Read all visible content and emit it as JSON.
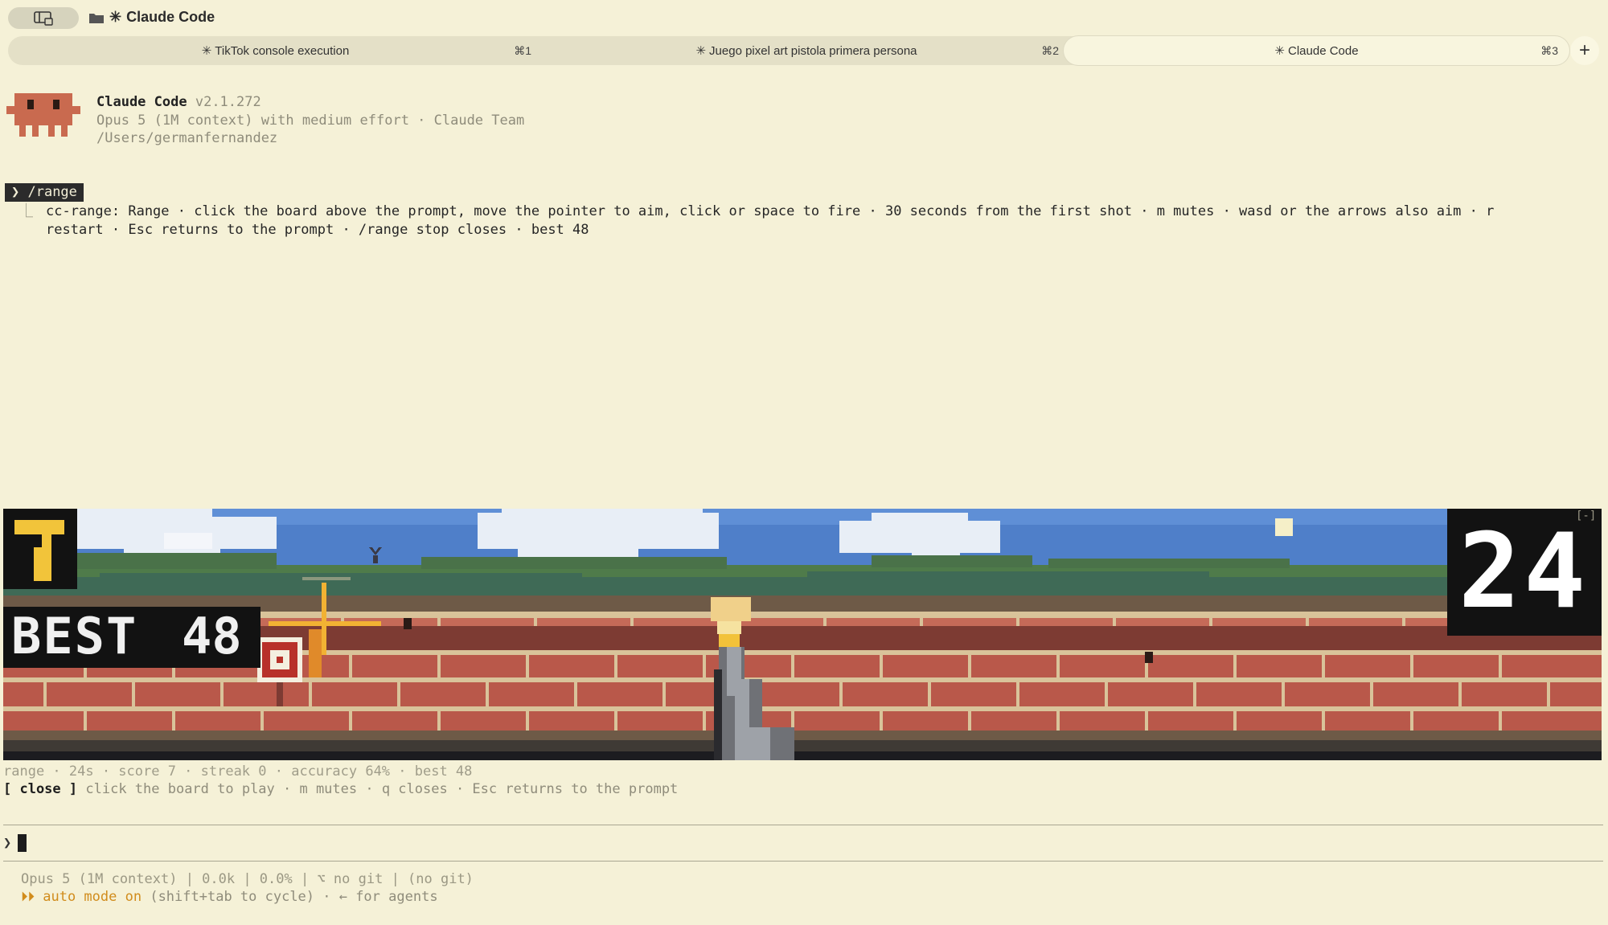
{
  "window": {
    "title": "Claude Code"
  },
  "tabs": [
    {
      "label": "TikTok console execution",
      "shortcut": "⌘1",
      "active": false
    },
    {
      "label": "Juego pixel art pistola primera persona",
      "shortcut": "⌘2",
      "active": false
    },
    {
      "label": "Claude Code",
      "shortcut": "⌘3",
      "active": true
    }
  ],
  "new_tab_label": "+",
  "header": {
    "app_name": "Claude Code",
    "version": "v2.1.272",
    "model_line": "Opus 5 (1M context) with medium effort · Claude Team",
    "cwd": "/Users/germanfernandez"
  },
  "command": {
    "input": "/range",
    "output_line1": "cc-range: Range · click the board above the prompt, move the pointer to aim, click or space to fire · 30 seconds from the first shot · m mutes · wasd or the arrows also aim · r",
    "output_line2": "restart · Esc returns to the prompt · /range stop closes · best 48"
  },
  "game": {
    "score_label": "7",
    "best_label": "BEST",
    "best_value": "48",
    "time_label": "24",
    "minimize_label": "[-]"
  },
  "status": {
    "line": "range · 24s · score 7 · streak 0 · accuracy 64% · best 48",
    "close_label": "[ close ]",
    "hint": "click the board to play · m mutes · q closes · Esc returns to the prompt"
  },
  "prompt": {
    "symbol": "❯"
  },
  "footer": {
    "line1": "Opus 5 (1M context) | 0.0k | 0.0% | ⌥ no git | (no git)",
    "auto_arrows": "⏵⏵",
    "auto_mode": "auto mode on",
    "auto_rest": "(shift+tab to cycle) · ← for agents"
  },
  "colors": {
    "background": "#f5f1d7",
    "accent": "#d18c1c",
    "crab": "#c96a4f"
  }
}
